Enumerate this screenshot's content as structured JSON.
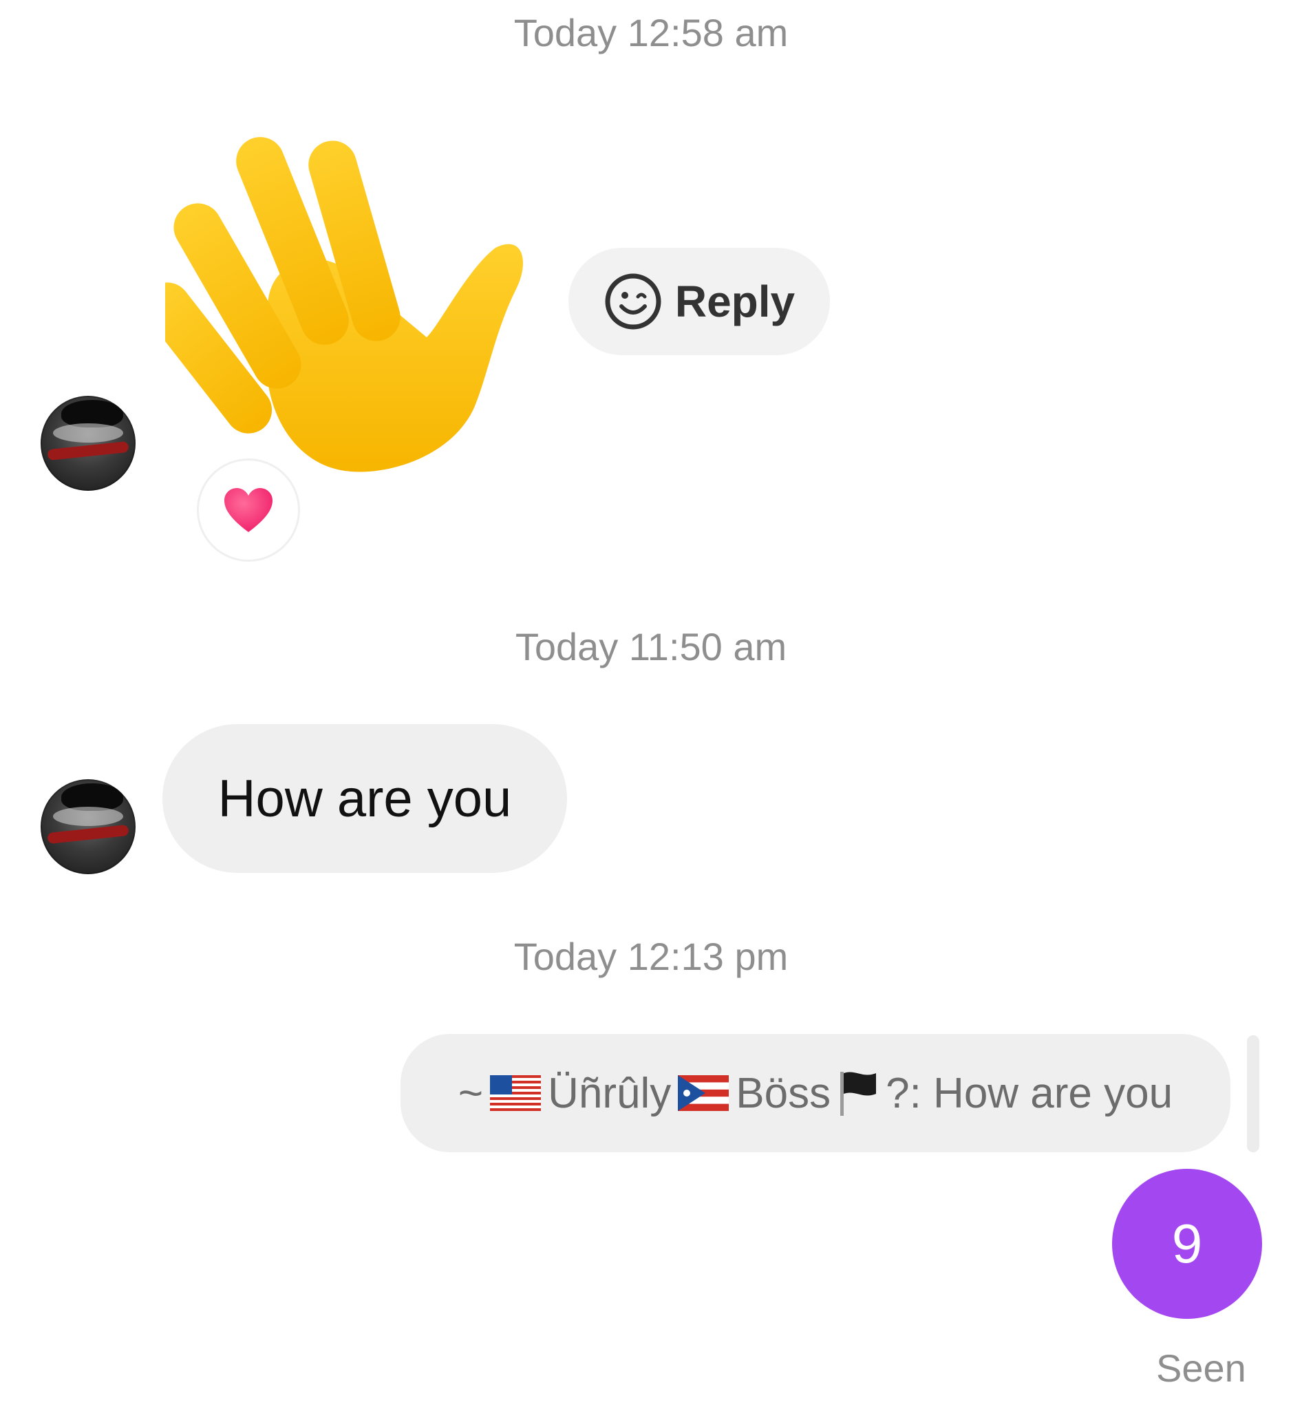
{
  "thread": {
    "timestamps": [
      "Today 12:58 am",
      "Today 11:50 am",
      "Today 12:13 pm"
    ],
    "wave_message": {
      "emoji": "wave-hand-emoji",
      "reply_label": "Reply",
      "reply_icon": "smiley-reply-icon",
      "reaction": "red-heart-emoji"
    },
    "received_message": {
      "text": "How are you"
    },
    "sent_message": {
      "prefix": "~",
      "flag1": "us-flag-emoji",
      "name_part1": "Üñrûly",
      "flag2": "puerto-rico-flag-emoji",
      "name_part2": "Böss",
      "flag3": "black-flag-emoji",
      "suffix": "?: How are you"
    },
    "badge": {
      "count": "9",
      "color": "#a347f0"
    },
    "status": "Seen"
  }
}
